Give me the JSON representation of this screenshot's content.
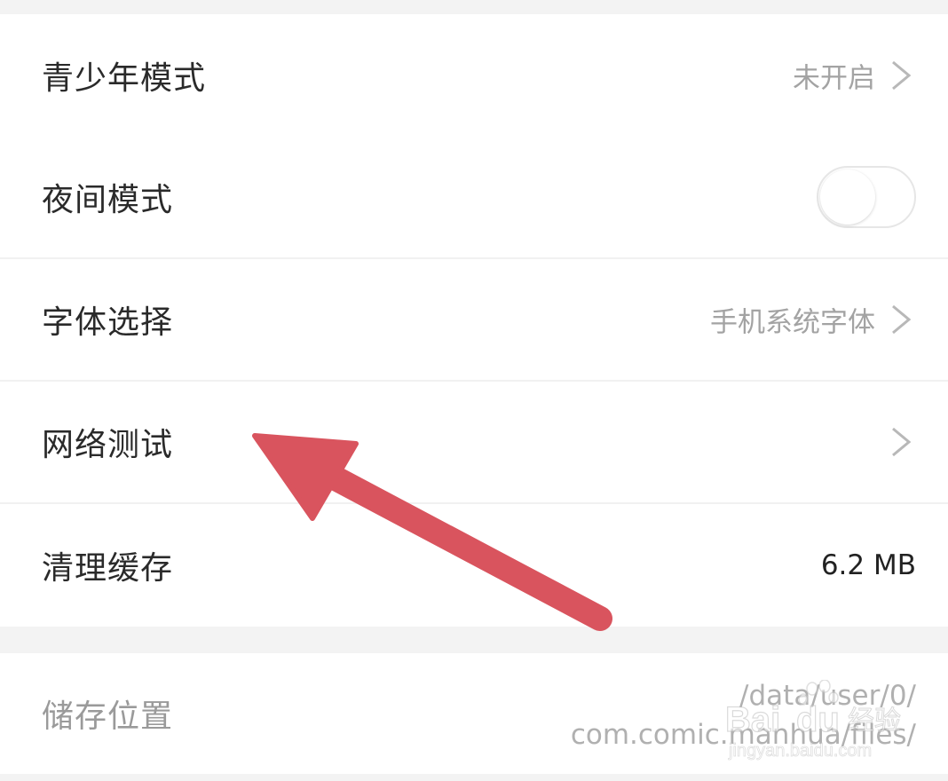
{
  "settings": {
    "items": [
      {
        "label": "青少年模式",
        "value": "未开启",
        "has_chevron": true
      },
      {
        "label": "夜间模式",
        "toggle_on": false
      },
      {
        "label": "字体选择",
        "value": "手机系统字体",
        "has_chevron": true
      },
      {
        "label": "网络测试",
        "value": "",
        "has_chevron": true
      },
      {
        "label": "清理缓存",
        "value": "6.2 MB"
      }
    ],
    "storage": {
      "label": "储存位置",
      "path_line1": "/data/user/0/",
      "path_line2": "com.comic.manhua/files/"
    }
  },
  "overlay": {
    "arrow_color": "#d9545e",
    "arrow_target": "网络测试"
  },
  "watermark": {
    "brand": "Bai du 经验",
    "url": "jingyan.baidu.com"
  }
}
